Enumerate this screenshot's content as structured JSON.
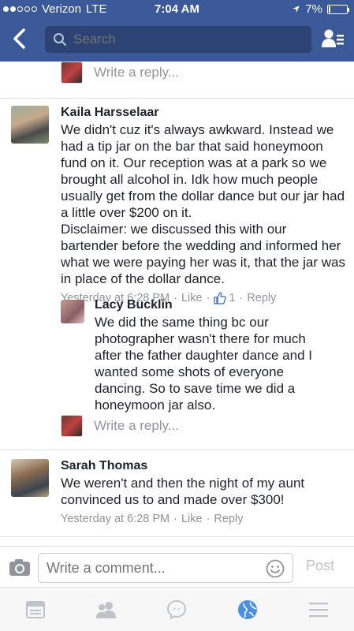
{
  "status": {
    "carrier": "Verizon",
    "network": "LTE",
    "time": "7:04 AM",
    "battery": "7%",
    "battery_level": 0.07
  },
  "search": {
    "placeholder": "Search"
  },
  "top_reply_prompt": "Write a reply...",
  "comments": [
    {
      "name": "Kaila Harsselaar",
      "text": "We didn't cuz it's always awkward. Instead we had a tip jar on the bar that said honeymoon fund on it. Our reception was at a park so we brought all alcohol in. Idk how much people usually get from the dollar dance but our jar had a little over $200 on it.\nDisclaimer: we discussed this with our bartender before the wedding and informed her what we were paying her was it, that the jar was in place of the dollar dance.",
      "time": "Yesterday at 6:28 PM",
      "like": "Like",
      "like_count": "1",
      "reply": "Reply"
    }
  ],
  "nested_reply": {
    "name": "Lacy Bucklin",
    "text": "We did the same thing bc our photographer wasn't there for much after the father daughter dance and I wanted some shots of everyone dancing. So to save time we did a honeymoon jar also."
  },
  "nested_reply_prompt": "Write a reply...",
  "second_comment": {
    "name": "Sarah Thomas",
    "text": "We weren't and then the night of my aunt convinced us to and made over $300!",
    "time": "Yesterday at 6:28 PM",
    "like": "Like",
    "reply": "Reply"
  },
  "composer": {
    "placeholder": "Write a comment...",
    "post_label": "Post"
  },
  "colors": {
    "brand": "#3b5998",
    "globe_active": "#4a90e2"
  },
  "icons": [
    "back-chevron-icon",
    "search-icon",
    "friends-list-icon",
    "thumbs-up-icon",
    "camera-icon",
    "smiley-icon",
    "news-feed-icon",
    "friends-icon",
    "messenger-icon",
    "globe-icon",
    "menu-icon"
  ]
}
